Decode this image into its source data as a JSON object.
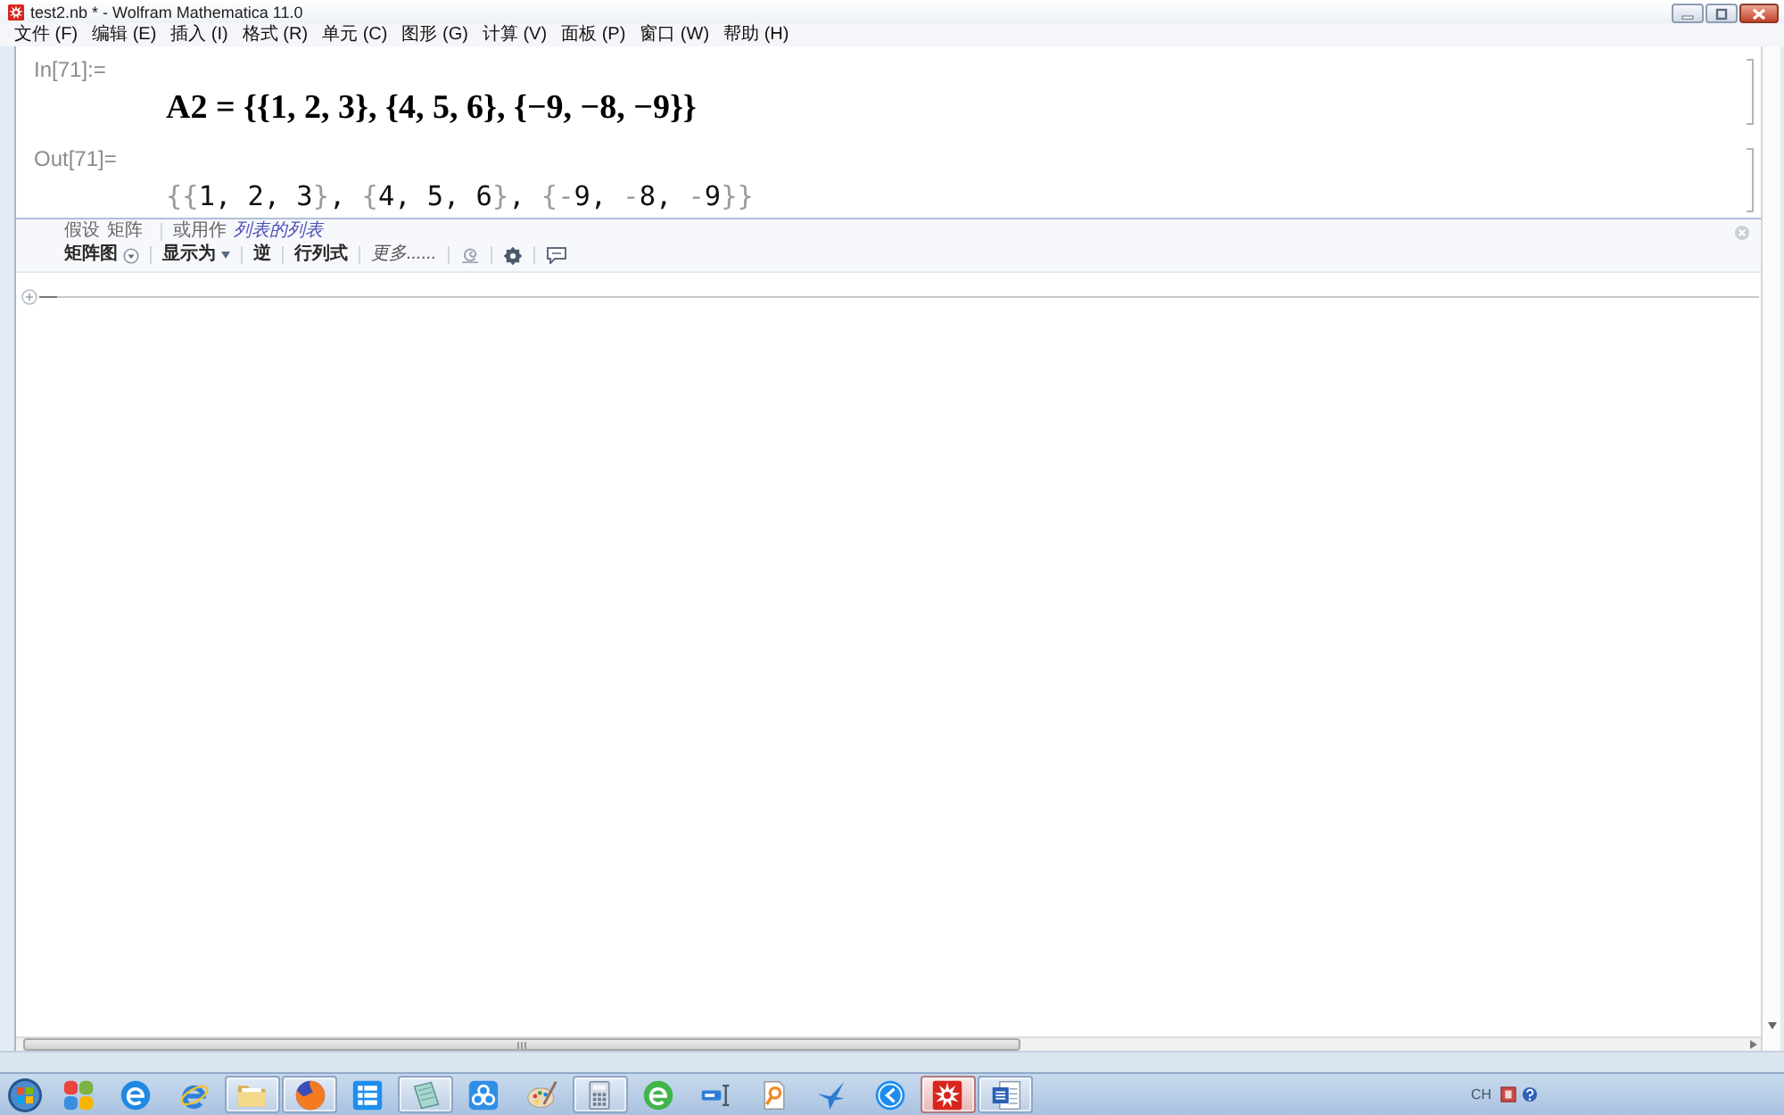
{
  "window": {
    "title": "test2.nb * - Wolfram Mathematica 11.0"
  },
  "menu": [
    "文件 (F)",
    "编辑 (E)",
    "插入 (I)",
    "格式 (R)",
    "单元 (C)",
    "图形 (G)",
    "计算 (V)",
    "面板 (P)",
    "窗口 (W)",
    "帮助 (H)"
  ],
  "cells": [
    {
      "kind": "input",
      "label": "In[71]:=",
      "content": "A2 = {{1, 2, 3}, {4, 5, 6}, {−9, −8, −9}}"
    },
    {
      "kind": "output",
      "label": "Out[71]=",
      "content": "{{1, 2, 3}, {4, 5, 6}, {-9, -8, -9}}"
    }
  ],
  "suggestions_bar": {
    "assumption": {
      "label": "假设",
      "value": "矩阵"
    },
    "alternative": {
      "label": "或用作",
      "link": "列表的列表"
    },
    "actions": [
      {
        "kind": "menu",
        "label": "矩阵图"
      },
      {
        "kind": "dropdown",
        "label": "显示为"
      },
      {
        "kind": "plain",
        "label": "逆"
      },
      {
        "kind": "plain",
        "label": "行列式"
      },
      {
        "kind": "more",
        "label": "更多......"
      }
    ]
  },
  "taskbar": {
    "apps": [
      {
        "open": false,
        "selected": false
      },
      {
        "open": false,
        "selected": false
      },
      {
        "open": false,
        "selected": false
      },
      {
        "open": true,
        "selected": false
      },
      {
        "open": true,
        "selected": false
      },
      {
        "open": false,
        "selected": false
      },
      {
        "open": true,
        "selected": false
      },
      {
        "open": false,
        "selected": false
      },
      {
        "open": false,
        "selected": false
      },
      {
        "open": true,
        "selected": false
      },
      {
        "open": false,
        "selected": false
      },
      {
        "open": false,
        "selected": false
      },
      {
        "open": false,
        "selected": false
      },
      {
        "open": false,
        "selected": false
      },
      {
        "open": false,
        "selected": false
      },
      {
        "open": true,
        "selected": true
      },
      {
        "open": true,
        "selected": false
      }
    ],
    "tray": {
      "language": "CH"
    }
  }
}
